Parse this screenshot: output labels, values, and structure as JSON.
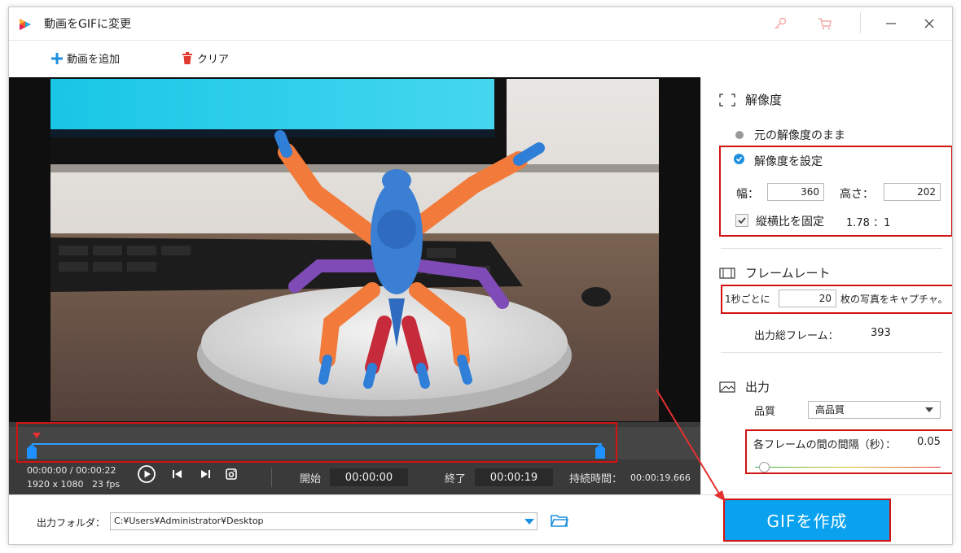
{
  "window": {
    "title": "動画をGIFに変更"
  },
  "toolbar": {
    "add_label": "動画を追加",
    "clear_label": "クリア"
  },
  "player": {
    "current_time": "00:00:00",
    "separator": "/",
    "total_time": "00:00:22",
    "resolution": "1920 x 1080",
    "fps": "23 fps",
    "start_label": "開始",
    "start_value": "00:00:00",
    "end_label": "終了",
    "end_value": "00:00:19",
    "duration_label": "持続時間：",
    "duration_value": "00:00:19.666"
  },
  "resolution": {
    "title": "解像度",
    "option_original": "元の解像度のまま",
    "option_custom": "解像度を設定",
    "width_label": "幅：",
    "width_value": "360",
    "height_label": "高さ：",
    "height_value": "202",
    "lock_ratio_label": "縦横比を固定",
    "ratio_value": "1.78 ：1"
  },
  "framerate": {
    "title": "フレームレート",
    "prefix": "1秒ごとに",
    "value": "20",
    "suffix": "枚の写真をキャプチャ。",
    "total_label": "出力総フレーム：",
    "total_value": "393"
  },
  "output": {
    "title": "出力",
    "quality_label": "品質",
    "quality_value": "高品質",
    "interval_label": "各フレームの間の間隔（秒）：",
    "interval_value": "0.05",
    "interval_level": 0.05
  },
  "bottom": {
    "folder_label": "出力フォルダ：",
    "folder_path": "C:¥Users¥Administrator¥Desktop",
    "create_label": "GIFを作成"
  },
  "colors": {
    "accent": "#0aa2ef",
    "highlight": "#d31212",
    "timeline_blue": "#1e90ff"
  }
}
